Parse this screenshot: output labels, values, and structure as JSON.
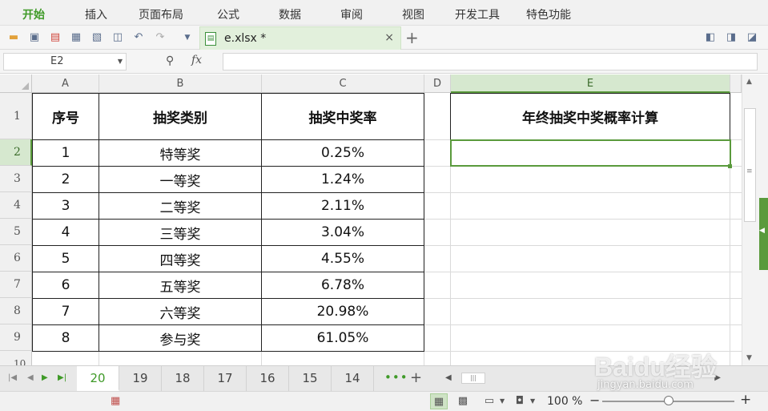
{
  "menu": {
    "items": [
      "开始",
      "插入",
      "页面布局",
      "公式",
      "数据",
      "审阅",
      "视图",
      "开发工具",
      "特色功能"
    ],
    "active_index": 0
  },
  "toolbar": {
    "icons": [
      "open-folder-icon",
      "save-icon",
      "export-pdf-icon",
      "print-icon",
      "print-preview-icon",
      "find-icon",
      "undo-icon",
      "redo-icon",
      "more-dropdown-icon"
    ],
    "right_icons": [
      "panel-icon",
      "format-icon",
      "collapse-icon"
    ]
  },
  "file_tab": {
    "name": "e.xlsx *",
    "close": "×",
    "new_tab": "+"
  },
  "formula_bar": {
    "name_box": "E2",
    "fx": "fx",
    "formula": ""
  },
  "grid": {
    "column_headers": [
      "A",
      "B",
      "C",
      "D",
      "E"
    ],
    "selected_column": "E",
    "row_headers": [
      "1",
      "2",
      "3",
      "4",
      "5",
      "6",
      "7",
      "8",
      "9",
      "10"
    ],
    "selected_row": "2",
    "table_header": [
      "序号",
      "抽奖类别",
      "抽奖中奖率"
    ],
    "rows": [
      [
        "1",
        "特等奖",
        "0.25%"
      ],
      [
        "2",
        "一等奖",
        "1.24%"
      ],
      [
        "3",
        "二等奖",
        "2.11%"
      ],
      [
        "4",
        "三等奖",
        "3.04%"
      ],
      [
        "5",
        "四等奖",
        "4.55%"
      ],
      [
        "6",
        "五等奖",
        "6.78%"
      ],
      [
        "7",
        "六等奖",
        "20.98%"
      ],
      [
        "8",
        "参与奖",
        "61.05%"
      ]
    ],
    "e1_title": "年终抽奖中奖概率计算"
  },
  "sheet_tabs": {
    "tabs": [
      "20",
      "19",
      "18",
      "17",
      "16",
      "15",
      "14"
    ],
    "active": "20",
    "more": "•••",
    "add": "+"
  },
  "status_bar": {
    "zoom": "100 %",
    "zoom_percent": 100
  },
  "watermark": {
    "text": "Baidu经验",
    "sub": "jingyan.baidu.com"
  },
  "colors": {
    "accent": "#3f9a28",
    "selection": "#5a9a3c",
    "header_bg": "#f0f0f0"
  }
}
